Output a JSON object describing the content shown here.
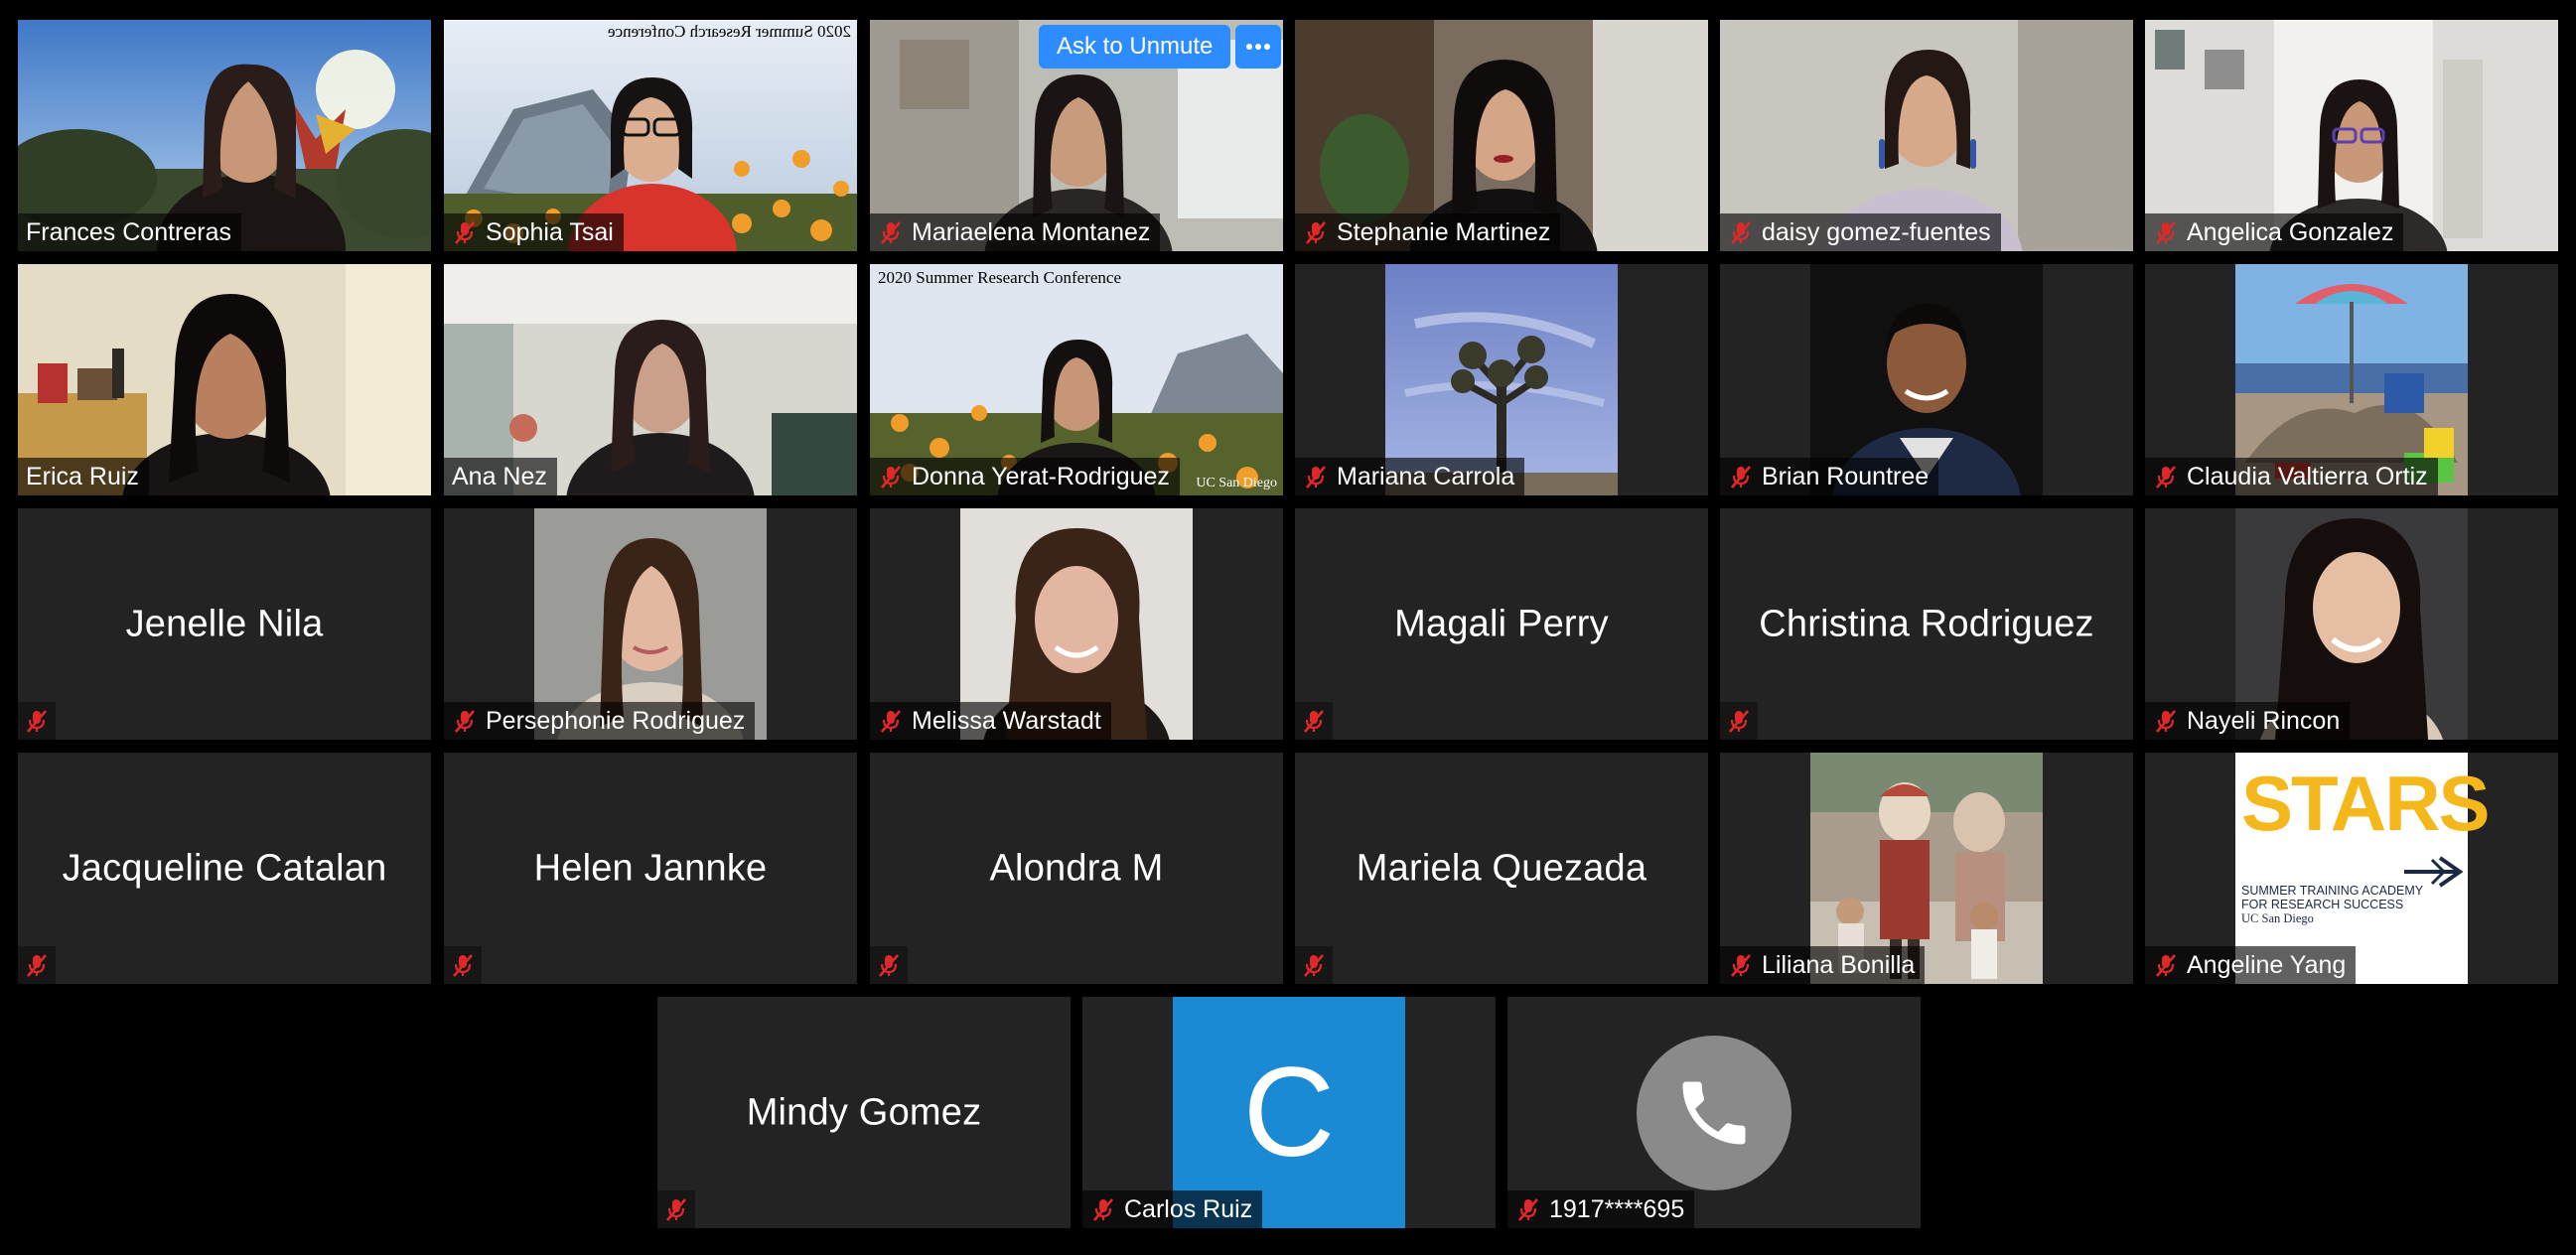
{
  "meeting": {
    "unmute_label": "Ask to Unmute",
    "more_label": "More options",
    "accent_color": "#2d8cff",
    "active_speaker_color": "#e4f08a"
  },
  "participants": {
    "frances_contreras": "Frances Contreras",
    "sophia_tsai": "Sophia Tsai",
    "sophia_tsai_banner": "2020 Summer Research Conference",
    "mariaelena_montanez": "Mariaelena Montanez",
    "stephanie_martinez": "Stephanie Martinez",
    "daisy_gomez_fuentes": "daisy gomez-fuentes",
    "angelica_gonzalez": "Angelica Gonzalez",
    "erica_ruiz": "Erica Ruiz",
    "ana_nez": "Ana Nez",
    "donna_yerat_rodriguez": "Donna Yerat-Rodriguez",
    "donna_banner": "2020 Summer Research Conference",
    "donna_footer": "UC San Diego",
    "mariana_carrola": "Mariana Carrola",
    "brian_rountree": "Brian Rountree",
    "claudia_valtierra_ortiz": "Claudia Valtierra Ortiz",
    "jenelle_nila": "Jenelle Nila",
    "persephonie_rodriguez": "Persephonie Rodriguez",
    "melissa_warstadt": "Melissa Warstadt",
    "magali_perry": "Magali Perry",
    "christina_rodriguez": "Christina Rodriguez",
    "nayeli_rincon": "Nayeli Rincon",
    "jacqueline_catalan": "Jacqueline Catalan",
    "helen_jannke": "Helen Jannke",
    "alondra_m": "Alondra M",
    "mariela_quezada": "Mariela Quezada",
    "liliana_bonilla": "Liliana Bonilla",
    "angeline_yang": "Angeline Yang",
    "stars_title": "STARS",
    "stars_subtitle_1": "SUMMER TRAINING ACADEMY",
    "stars_subtitle_2": "FOR RESEARCH SUCCESS",
    "stars_subtitle_3": "UC San Diego",
    "mindy_gomez": "Mindy Gomez",
    "carlos_ruiz": "Carlos Ruiz",
    "carlos_initial": "C",
    "phone_caller": "1917****695"
  }
}
